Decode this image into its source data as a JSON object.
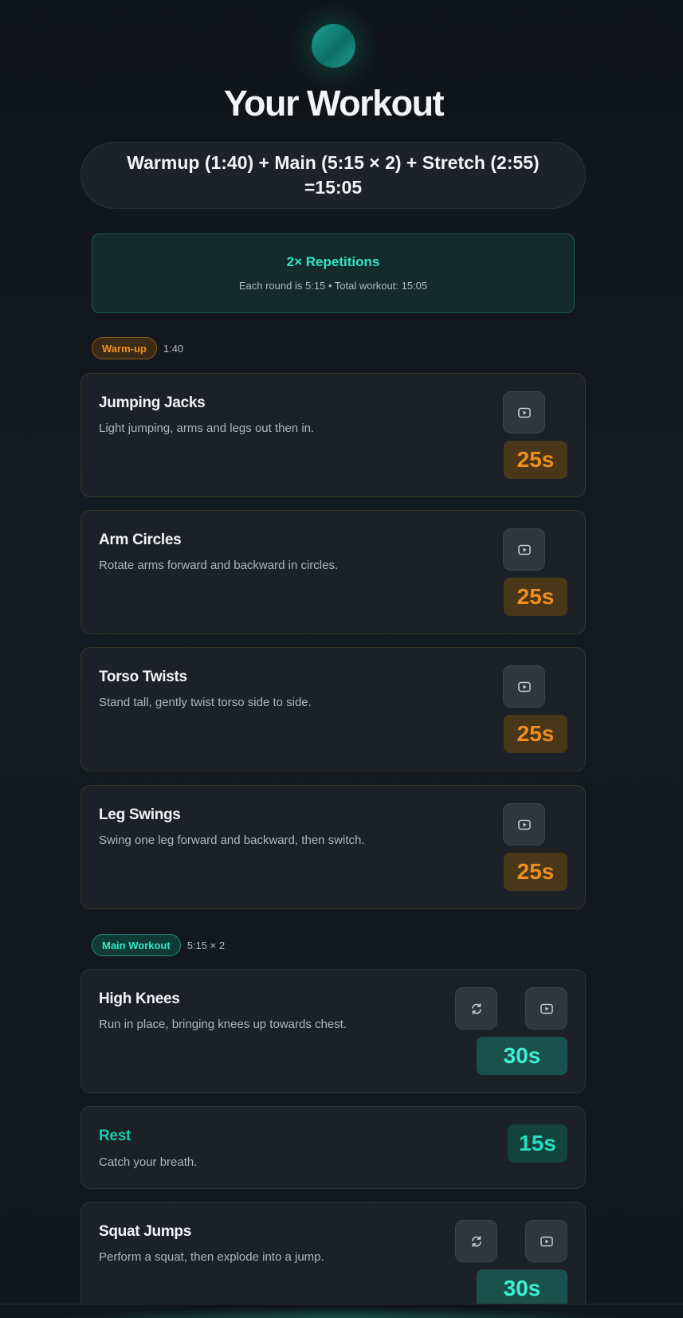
{
  "header": {
    "title": "Your Workout",
    "formula": "Warmup (1:40) + Main (5:15 × 2) + Stretch (2:55) =15:05"
  },
  "repetitions": {
    "title": "2× Repetitions",
    "subtitle": "Each round is 5:15 • Total workout: 15:05"
  },
  "sections": {
    "warmup": {
      "label": "Warm-up",
      "meta": "1:40"
    },
    "main": {
      "label": "Main Workout",
      "meta": "5:15 × 2"
    }
  },
  "warmup_exercises": [
    {
      "name": "Jumping Jacks",
      "description": "Light jumping, arms and legs out then in.",
      "duration": "25s"
    },
    {
      "name": "Arm Circles",
      "description": "Rotate arms forward and backward in circles.",
      "duration": "25s"
    },
    {
      "name": "Torso Twists",
      "description": "Stand tall, gently twist torso side to side.",
      "duration": "25s"
    },
    {
      "name": "Leg Swings",
      "description": "Swing one leg forward and backward, then switch.",
      "duration": "25s"
    }
  ],
  "main_exercises": [
    {
      "name": "High Knees",
      "description": "Run in place, bringing knees up towards chest.",
      "duration": "30s"
    },
    {
      "name": "Rest",
      "description": "Catch your breath.",
      "duration": "15s"
    },
    {
      "name": "Squat Jumps",
      "description": "Perform a squat, then explode into a jump.",
      "duration": "30s"
    }
  ],
  "icons": {
    "video": "play-video-icon",
    "swap": "swap-refresh-icon",
    "logo": "logo-orb"
  },
  "colors": {
    "accent_teal": "#2ee6c7",
    "warmup_orange": "#f0921c",
    "background": "#0f1419"
  }
}
